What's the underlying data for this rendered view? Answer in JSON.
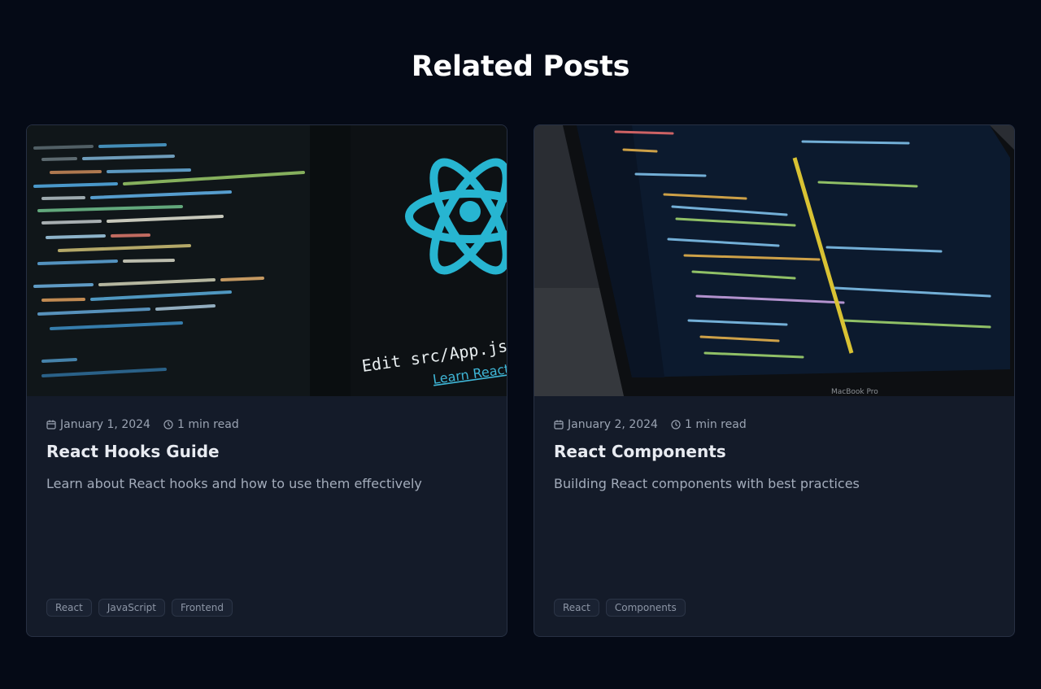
{
  "section": {
    "title": "Related Posts"
  },
  "posts": [
    {
      "date": "January 1, 2024",
      "read_time": "1 min read",
      "title": "React Hooks Guide",
      "description": "Learn about React hooks and how to use them effectively",
      "tags": [
        "React",
        "JavaScript",
        "Frontend"
      ],
      "image": {
        "overlay_line1": "Edit src/App.js and save",
        "overlay_line2": "Learn React"
      }
    },
    {
      "date": "January 2, 2024",
      "read_time": "1 min read",
      "title": "React Components",
      "description": "Building React components with best practices",
      "tags": [
        "React",
        "Components"
      ],
      "image": {
        "laptop_label": "MacBook Pro"
      }
    }
  ],
  "colors": {
    "background": "#050a16",
    "card": "#141b29",
    "react_cyan": "#27b5d1"
  },
  "icons": {
    "date": "calendar-icon",
    "read_time": "clock-icon"
  }
}
